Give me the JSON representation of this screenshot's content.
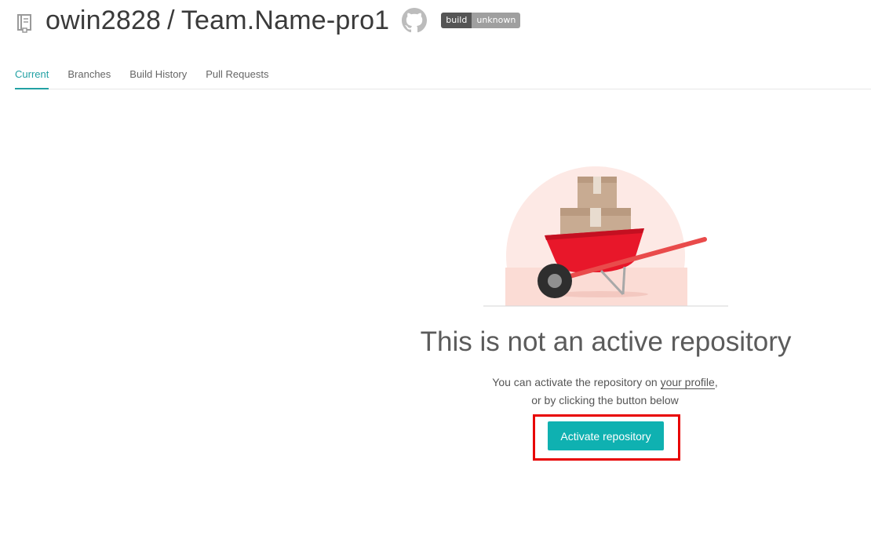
{
  "header": {
    "owner": "owin2828",
    "separator": "/",
    "repo": "Team.Name-pro1",
    "badge_left": "build",
    "badge_right": "unknown",
    "repo_icon": "repo-book-icon",
    "github_icon": "github-icon"
  },
  "tabs": [
    {
      "label": "Current",
      "active": true
    },
    {
      "label": "Branches",
      "active": false
    },
    {
      "label": "Build History",
      "active": false
    },
    {
      "label": "Pull Requests",
      "active": false
    }
  ],
  "empty_state": {
    "headline": "This is not an active repository",
    "line1_prefix": "You can activate the repository on ",
    "line1_link": "your profile",
    "line1_suffix": ",",
    "line2": "or by clicking the button below",
    "button_label": "Activate repository",
    "illustration_icon": "wheelbarrow-boxes-illustration"
  },
  "colors": {
    "accent": "#22a1a4",
    "button": "#0fb1b1",
    "highlight": "#e80000",
    "wheelbarrow": "#e8172a"
  }
}
